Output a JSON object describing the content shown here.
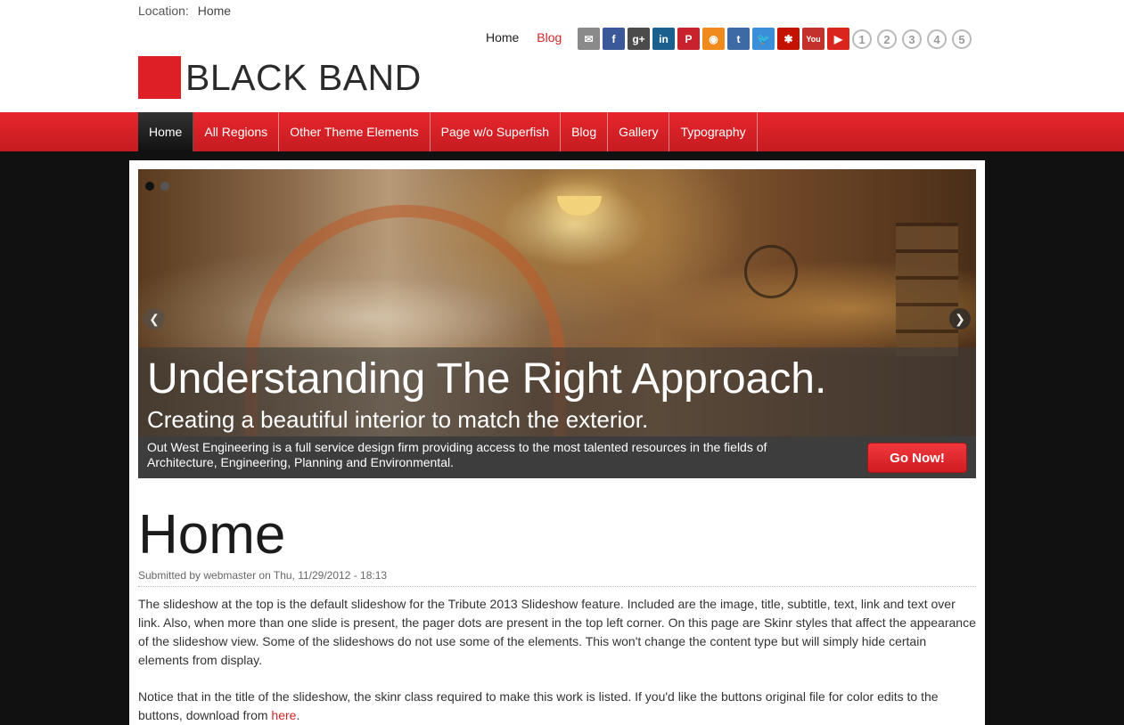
{
  "breadcrumb": {
    "label": "Location:",
    "current": "Home"
  },
  "top_links": {
    "home": "Home",
    "blog": "Blog"
  },
  "social_icons": [
    {
      "name": "email-icon",
      "glyph": "✉",
      "color": "#8a8a8a"
    },
    {
      "name": "facebook-icon",
      "glyph": "f",
      "color": "#3b5998"
    },
    {
      "name": "google-plus-icon",
      "glyph": "g+",
      "color": "#4b4b4b"
    },
    {
      "name": "linkedin-icon",
      "glyph": "in",
      "color": "#1b5f8f"
    },
    {
      "name": "pinterest-icon",
      "glyph": "P",
      "color": "#c8232c"
    },
    {
      "name": "rss-icon",
      "glyph": "◉",
      "color": "#f08a1c"
    },
    {
      "name": "tumblr-icon",
      "glyph": "t",
      "color": "#3d6aa5"
    },
    {
      "name": "twitter-icon",
      "glyph": "🐦",
      "color": "#3b8ed8"
    },
    {
      "name": "yelp-icon",
      "glyph": "✱",
      "color": "#c41200"
    },
    {
      "name": "youtube-icon",
      "glyph": "You",
      "color": "#c4302b"
    },
    {
      "name": "youtube-play-icon",
      "glyph": "▶",
      "color": "#d9251d"
    }
  ],
  "numbered_icons": [
    "1",
    "2",
    "3",
    "4",
    "5"
  ],
  "logo": {
    "text": "BLACK BAND",
    "color": "#df1f26"
  },
  "nav": [
    "Home",
    "All Regions",
    "Other Theme Elements",
    "Page w/o Superfish",
    "Blog",
    "Gallery",
    "Typography"
  ],
  "slideshow": {
    "title": "Understanding The Right Approach.",
    "subtitle": "Creating a beautiful interior to match the exterior.",
    "text": "Out West Engineering is a full service design firm providing access to the most talented resources in the fields of Architecture, Engineering, Planning and Environmental.",
    "button": "Go Now!",
    "pager_count": 2,
    "active_slide": 1
  },
  "page": {
    "title": "Home",
    "submitted": "Submitted by webmaster on Thu, 11/29/2012 - 18:13",
    "para1": "The slideshow at the top is the default slideshow for the Tribute 2013 Slideshow feature. Included are the image, title, subtitle, text, link and text over link. Also, when more than one slide is present, the pager dots are present in the top left corner. On this page are Skinr styles that affect the appearance of the slideshow view. Some of the slideshows do not use some of the elements. This won't change the content type but will simply hide certain elements from display.",
    "para2_before": "Notice that in the title of the slideshow, the skinr class required to make this work is listed. If you'd like the buttons original file for color edits to the buttons, download from ",
    "para2_link": "here",
    "para2_after": "."
  }
}
